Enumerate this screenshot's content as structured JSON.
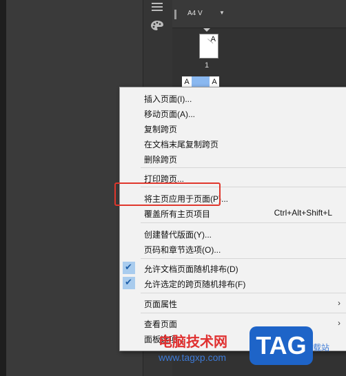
{
  "panel": {
    "master_select": "A4 V",
    "page_number": "1",
    "page_prefix": "A",
    "spread_left": "A",
    "spread_right": "A"
  },
  "menu": {
    "items": [
      {
        "label": "插入页面(I)..."
      },
      {
        "label": "移动页面(A)..."
      },
      {
        "label": "复制跨页"
      },
      {
        "label": "在文档末尾复制跨页"
      },
      {
        "label": "删除跨页"
      },
      {
        "label": "打印跨页..."
      },
      {
        "label": "将主页应用于页面(P)..."
      },
      {
        "label": "覆盖所有主页项目",
        "shortcut": "Ctrl+Alt+Shift+L"
      },
      {
        "label": "创建替代版面(Y)..."
      },
      {
        "label": "页码和章节选项(O)..."
      },
      {
        "label": "允许文档页面随机排布(D)",
        "checked": true
      },
      {
        "label": "允许选定的跨页随机排布(F)",
        "checked": true
      },
      {
        "label": "页面属性",
        "submenu": true
      },
      {
        "label": "查看页面",
        "submenu": true
      },
      {
        "label": "面板选项..."
      }
    ],
    "check_glyph": "✔",
    "submenu_glyph": "›"
  },
  "watermark": {
    "title": "电脑技术网",
    "url": "www.tagxp.com",
    "tag": "TAG",
    "tail": "载站"
  },
  "colors": {
    "highlight_box": "#e0362b",
    "check_color": "#1f5fa8",
    "check_bg": "#a9ccee",
    "menu_bg": "#f2f2f2"
  }
}
